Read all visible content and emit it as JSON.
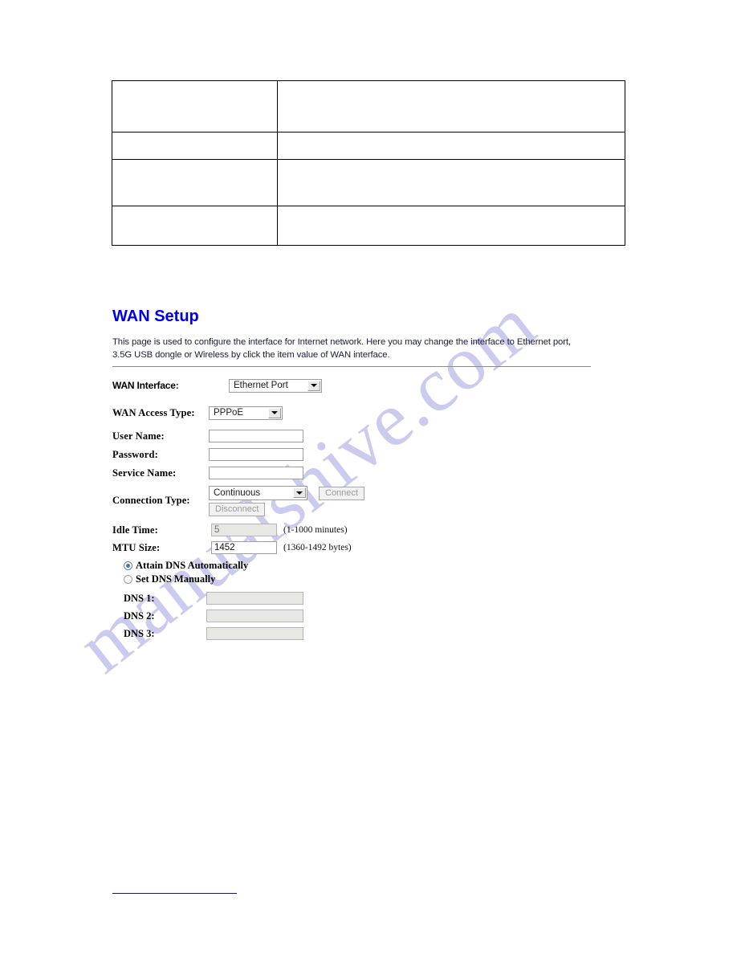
{
  "document": {
    "watermark_text": "manualshive.com",
    "watermark_color": "#c9c8ef"
  },
  "top_table": {
    "rows": [
      {
        "col1": "",
        "col2": ""
      },
      {
        "col1": "",
        "col2": ""
      },
      {
        "col1": "",
        "col2": ""
      },
      {
        "col1": "",
        "col2": ""
      }
    ]
  },
  "wan_setup": {
    "title": "WAN Setup",
    "title_color": "#0000ee",
    "description": "This page is used to configure the interface for Internet network. Here you may change the interface to Ethernet port, 3.5G USB dongle or Wireless by click the item value of WAN interface.",
    "fields": {
      "wan_interface": {
        "label": "WAN Interface:",
        "value": "Ethernet Port"
      },
      "wan_access_type": {
        "label": "WAN Access Type:",
        "value": "PPPoE"
      },
      "user_name": {
        "label": "User Name:",
        "value": ""
      },
      "password": {
        "label": "Password:",
        "value": ""
      },
      "service_name": {
        "label": "Service Name:",
        "value": ""
      },
      "connection_type": {
        "label": "Connection Type:",
        "value": "Continuous",
        "connect_button": "Connect",
        "disconnect_button": "Disconnect"
      },
      "idle_time": {
        "label": "Idle Time:",
        "value": "5",
        "hint": "(1-1000 minutes)"
      },
      "mtu_size": {
        "label": "MTU Size:",
        "value": "1452",
        "hint": "(1360-1492 bytes)"
      }
    },
    "dns": {
      "attain_automatically_label": "Attain DNS Automatically",
      "set_manually_label": "Set DNS Manually",
      "selected": "attain_automatically",
      "entries": [
        {
          "label": "DNS 1:",
          "value": ""
        },
        {
          "label": "DNS 2:",
          "value": ""
        },
        {
          "label": "DNS 3:",
          "value": ""
        }
      ]
    }
  }
}
